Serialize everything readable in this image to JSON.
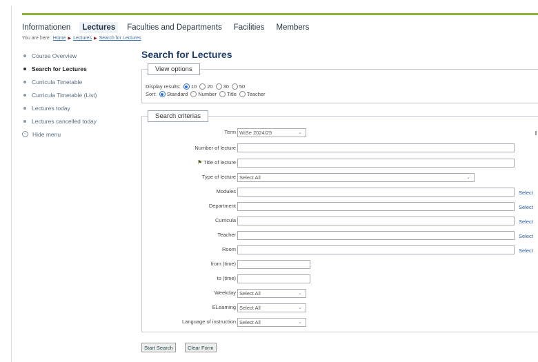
{
  "topnav": {
    "items": [
      "Informationen",
      "Lectures",
      "Faculties and Departments",
      "Facilities",
      "Members"
    ],
    "active": "Lectures"
  },
  "breadcrumb": {
    "prefix": "You are here:",
    "items": [
      "Home",
      "Lectures",
      "Search for Lectures"
    ]
  },
  "sidebar": {
    "items": [
      "Course Overview",
      "Search for Lectures",
      "Curricula Timetable",
      "Curricula Timetable (List)",
      "Lectures today",
      "Lectures cancelled today"
    ],
    "active": "Search for Lectures",
    "hide": "Hide menu"
  },
  "page_title": "Search for Lectures",
  "view_options": {
    "legend": "View options",
    "display_label": "Display results:",
    "display_options": [
      "10",
      "20",
      "30",
      "50"
    ],
    "display_selected": "10",
    "sort_label": "Sort:",
    "sort_options": [
      "Standard",
      "Number",
      "Title",
      "Teacher"
    ],
    "sort_selected": "Standard"
  },
  "criteria": {
    "legend": "Search criterias",
    "term": {
      "label": "Term",
      "value": "WiSe 2024/25"
    },
    "number": {
      "label": "Number of lecture",
      "value": ""
    },
    "title": {
      "label": "Title of lecture",
      "value": ""
    },
    "type": {
      "label": "Type of lecture",
      "value": "Select All"
    },
    "modules": {
      "label": "Modules",
      "value": "",
      "select": "Select"
    },
    "department": {
      "label": "Department",
      "value": "",
      "select": "Select"
    },
    "curricula": {
      "label": "Curricula",
      "value": "",
      "select": "Select"
    },
    "teacher": {
      "label": "Teacher",
      "value": "",
      "select": "Select"
    },
    "room": {
      "label": "Room",
      "value": "",
      "select": "Select"
    },
    "from_time": {
      "label": "from (time)",
      "value": ""
    },
    "to_time": {
      "label": "to (time)",
      "value": ""
    },
    "weekday": {
      "label": "Weekday",
      "value": "Select All"
    },
    "elearning": {
      "label": "ELearning",
      "value": "Select All"
    },
    "language": {
      "label": "Language of instruction",
      "value": "Select All"
    }
  },
  "buttons": {
    "start": "Start Search",
    "clear": "Clear Form"
  },
  "colors": {
    "accent_line": "#8ab43c",
    "title": "#1f3d6b",
    "link": "#3a6ea5",
    "radio": "#2b6fd6"
  }
}
